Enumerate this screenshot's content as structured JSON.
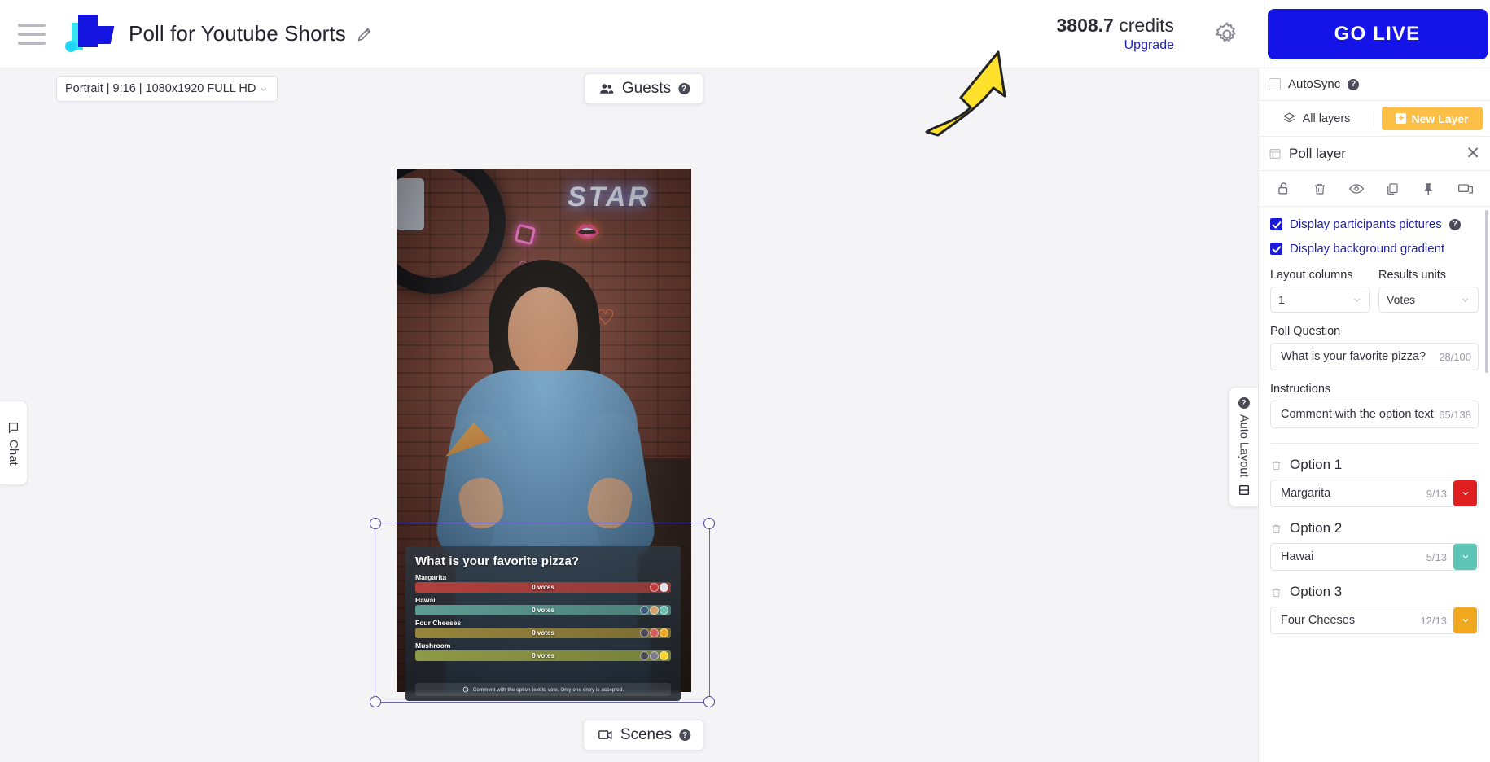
{
  "header": {
    "menu_icon": "hamburger-icon",
    "logo": "brand-logo",
    "project_title": "Poll for Youtube Shorts",
    "edit_icon": "pencil-icon",
    "credits_amount": "3808.7",
    "credits_unit": "credits",
    "upgrade_label": "Upgrade",
    "settings_icon": "gear-icon",
    "go_live_label": "GO LIVE"
  },
  "canvas": {
    "format_value": "Portrait | 9:16 | 1080x1920 FULL HD",
    "guests_label": "Guests",
    "scenes_label": "Scenes",
    "chat_label": "Chat",
    "auto_layout_label": "Auto Layout"
  },
  "poll_overlay": {
    "question": "What is your favorite pizza?",
    "options": [
      {
        "label": "Margarita",
        "votes": "0 votes",
        "color": "#b4403c"
      },
      {
        "label": "Hawai",
        "votes": "0 votes",
        "color": "#5d9c94"
      },
      {
        "label": "Four Cheeses",
        "votes": "0 votes",
        "color": "#97853e"
      },
      {
        "label": "Mushroom",
        "votes": "0 votes",
        "color": "#8f9a45"
      }
    ],
    "footer_note": "Comment with the option text to vote. Only one entry is accepted."
  },
  "right_panel": {
    "autosync_label": "AutoSync",
    "autosync_checked": false,
    "all_layers_label": "All layers",
    "new_layer_label": "New Layer",
    "layer_name": "Poll layer",
    "close_icon": "close-icon",
    "tools": [
      "unlock-icon",
      "trash-icon",
      "eye-icon",
      "duplicate-icon",
      "pin-icon",
      "screen-icon"
    ],
    "display_participants_label": "Display participants pictures",
    "display_participants_checked": true,
    "display_gradient_label": "Display background gradient",
    "display_gradient_checked": true,
    "layout_columns_label": "Layout columns",
    "layout_columns_value": "1",
    "results_units_label": "Results units",
    "results_units_value": "Votes",
    "poll_question_label": "Poll Question",
    "poll_question_value": "What is your favorite pizza?",
    "poll_question_count": "28/100",
    "instructions_label": "Instructions",
    "instructions_value": "Comment with the option text",
    "instructions_count": "65/138",
    "options": [
      {
        "title": "Option 1",
        "value": "Margarita",
        "count": "9/13",
        "color": "#e02020"
      },
      {
        "title": "Option 2",
        "value": "Hawai",
        "count": "5/13",
        "color": "#5ec4b6"
      },
      {
        "title": "Option 3",
        "value": "Four Cheeses",
        "count": "12/13",
        "color": "#f0a81e"
      }
    ]
  },
  "colors": {
    "accent_blue": "#1414e8",
    "amber": "#fbbf45",
    "arrow_yellow": "#ffe02a"
  }
}
